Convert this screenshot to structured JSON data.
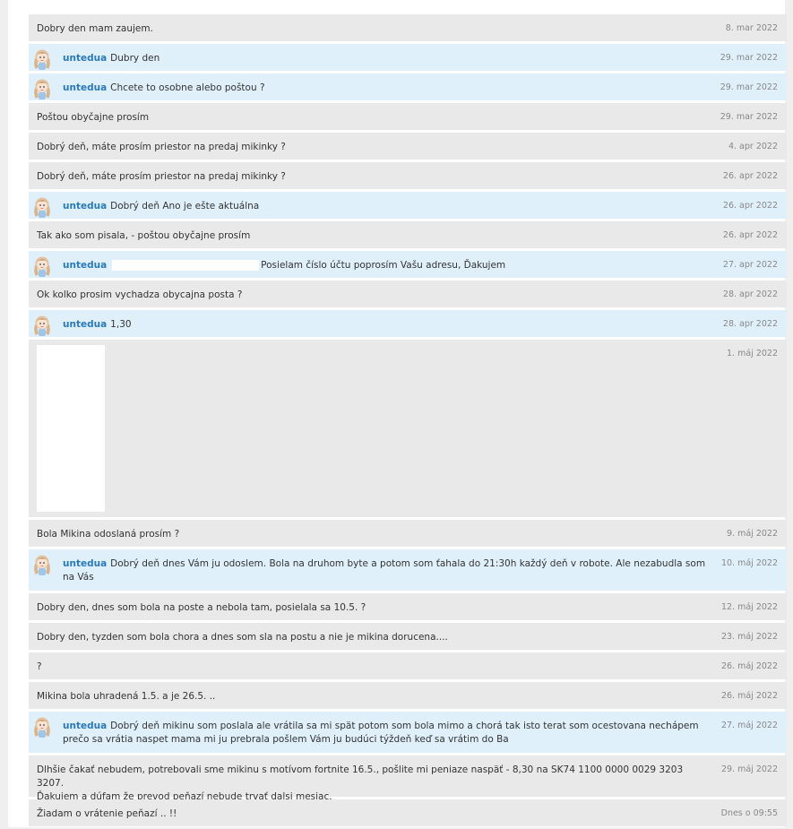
{
  "messages": [
    {
      "sender": "buyer",
      "name": "",
      "text": "Dobry den mam zaujem.",
      "date": "8. mar 2022"
    },
    {
      "sender": "seller",
      "name": "untedua",
      "text": "Dubry den",
      "date": "29. mar 2022"
    },
    {
      "sender": "seller",
      "name": "untedua",
      "text": "Chcete to osobne alebo poštou ?",
      "date": "29. mar 2022"
    },
    {
      "sender": "buyer",
      "name": "",
      "text": "Poštou obyčajne prosím",
      "date": "29. mar 2022"
    },
    {
      "sender": "buyer",
      "name": "",
      "text": "Dobrý deň, máte prosím priestor na predaj mikinky ?",
      "date": "4. apr 2022"
    },
    {
      "sender": "buyer",
      "name": "",
      "text": "Dobrý deň, máte prosím priestor na predaj mikinky ?",
      "date": "26. apr 2022"
    },
    {
      "sender": "seller",
      "name": "untedua",
      "text": "Dobrý deň Ano je ešte aktuálna",
      "date": "26. apr 2022"
    },
    {
      "sender": "buyer",
      "name": "",
      "text": "Tak ako som pisala, - poštou obyčajne prosím",
      "date": "26. apr 2022"
    },
    {
      "sender": "seller",
      "name": "untedua",
      "text": "Posielam číslo účtu poprosím Vašu adresu, Ďakujem",
      "date": "27. apr 2022",
      "redacted": true
    },
    {
      "sender": "buyer",
      "name": "",
      "text": "Ok kolko prosim vychadza obycajna posta ?",
      "date": "28. apr 2022"
    },
    {
      "sender": "seller",
      "name": "untedua",
      "text": "1,30",
      "date": "28. apr 2022"
    },
    {
      "sender": "buyer",
      "name": "",
      "text": "",
      "date": "1. máj 2022",
      "image": true
    },
    {
      "sender": "buyer",
      "name": "",
      "text": "Bola Mikina odoslaná prosím ?",
      "date": "9. máj 2022"
    },
    {
      "sender": "seller",
      "name": "untedua",
      "text": "Dobrý deň dnes Vám ju odoslem. Bola na druhom byte a potom som ťahala do 21:30h každý deň v robote. Ale nezabudla som na Vás",
      "date": "10. máj 2022"
    },
    {
      "sender": "buyer",
      "name": "",
      "text": "Dobry den, dnes som bola na poste a nebola tam, posielala sa 10.5. ?",
      "date": "12. máj 2022"
    },
    {
      "sender": "buyer",
      "name": "",
      "text": "Dobry den, tyzden som bola chora a dnes som sla na postu a nie je mikina dorucena....",
      "date": "23. máj 2022"
    },
    {
      "sender": "buyer",
      "name": "",
      "text": "?",
      "date": "26. máj 2022"
    },
    {
      "sender": "buyer",
      "name": "",
      "text": "Mikina bola uhradená 1.5. a je 26.5. ..",
      "date": "26. máj 2022"
    },
    {
      "sender": "seller",
      "name": "untedua",
      "text": "Dobrý deň mikinu som poslala ale vrátila sa mi spät potom som bola mimo a chorá tak isto terat som ocestovana nechápem prečo sa vrátia naspet mama mi ju prebrala pošlem Vám ju budúci týždeň keď sa vrátim do Ba",
      "date": "27. máj 2022"
    },
    {
      "sender": "buyer",
      "name": "",
      "text": "Dlhšie čakať nebudem, potrebovali sme mikinu s motívom fortnite 16.5., pošlite mi peniaze naspäť - 8,30 na SK74 1100 0000 0029 3203 3207.\nĎakujem a dúfam že prevod peňazí nebude trvať dalsi mesiac.",
      "date": "29. máj 2022"
    },
    {
      "sender": "buyer",
      "name": "",
      "text": "Žiadam o vrátenie peňazí .. !!",
      "date": "Dnes o 09:55"
    }
  ],
  "avatar_icon": "girl-avatar-icon",
  "colors": {
    "buyer_bg": "#e9e9e9",
    "seller_bg": "#dff0fb",
    "name": "#2a7ab8",
    "date": "#888888"
  }
}
